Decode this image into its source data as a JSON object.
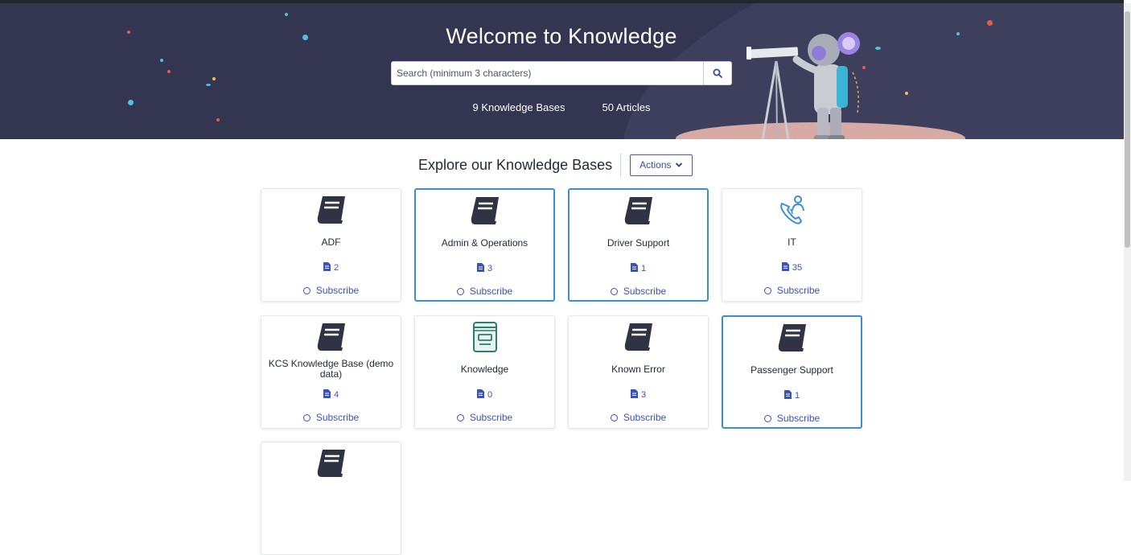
{
  "hero": {
    "title": "Welcome to Knowledge",
    "search_placeholder": "Search (minimum 3 characters)",
    "stats": [
      "9 Knowledge Bases",
      "50 Articles"
    ]
  },
  "explore": {
    "title": "Explore our Knowledge Bases",
    "actions_label": "Actions"
  },
  "knowledge_bases": [
    {
      "name": "ADF",
      "count": "2",
      "subscribe": "Subscribe",
      "icon": "book-icon",
      "selected": false
    },
    {
      "name": "Admin & Operations",
      "count": "3",
      "subscribe": "Subscribe",
      "icon": "book-icon",
      "selected": true
    },
    {
      "name": "Driver Support",
      "count": "1",
      "subscribe": "Subscribe",
      "icon": "book-icon",
      "selected": true
    },
    {
      "name": "IT",
      "count": "35",
      "subscribe": "Subscribe",
      "icon": "phone-person-icon",
      "selected": false
    },
    {
      "name": "KCS Knowledge Base (demo data)",
      "count": "4",
      "subscribe": "Subscribe",
      "icon": "book-icon",
      "selected": false
    },
    {
      "name": "Knowledge",
      "count": "0",
      "subscribe": "Subscribe",
      "icon": "kb-device-icon",
      "selected": false
    },
    {
      "name": "Known Error",
      "count": "3",
      "subscribe": "Subscribe",
      "icon": "book-icon",
      "selected": false
    },
    {
      "name": "Passenger Support",
      "count": "1",
      "subscribe": "Subscribe",
      "icon": "book-icon",
      "selected": true
    },
    {
      "name": "",
      "count": "",
      "subscribe": "",
      "icon": "book-icon",
      "selected": false
    }
  ],
  "colors": {
    "hero_bg": "#343651",
    "accent": "#3b53b6",
    "selected_border": "#3b8ed6",
    "icon_dark": "#2f3344"
  }
}
